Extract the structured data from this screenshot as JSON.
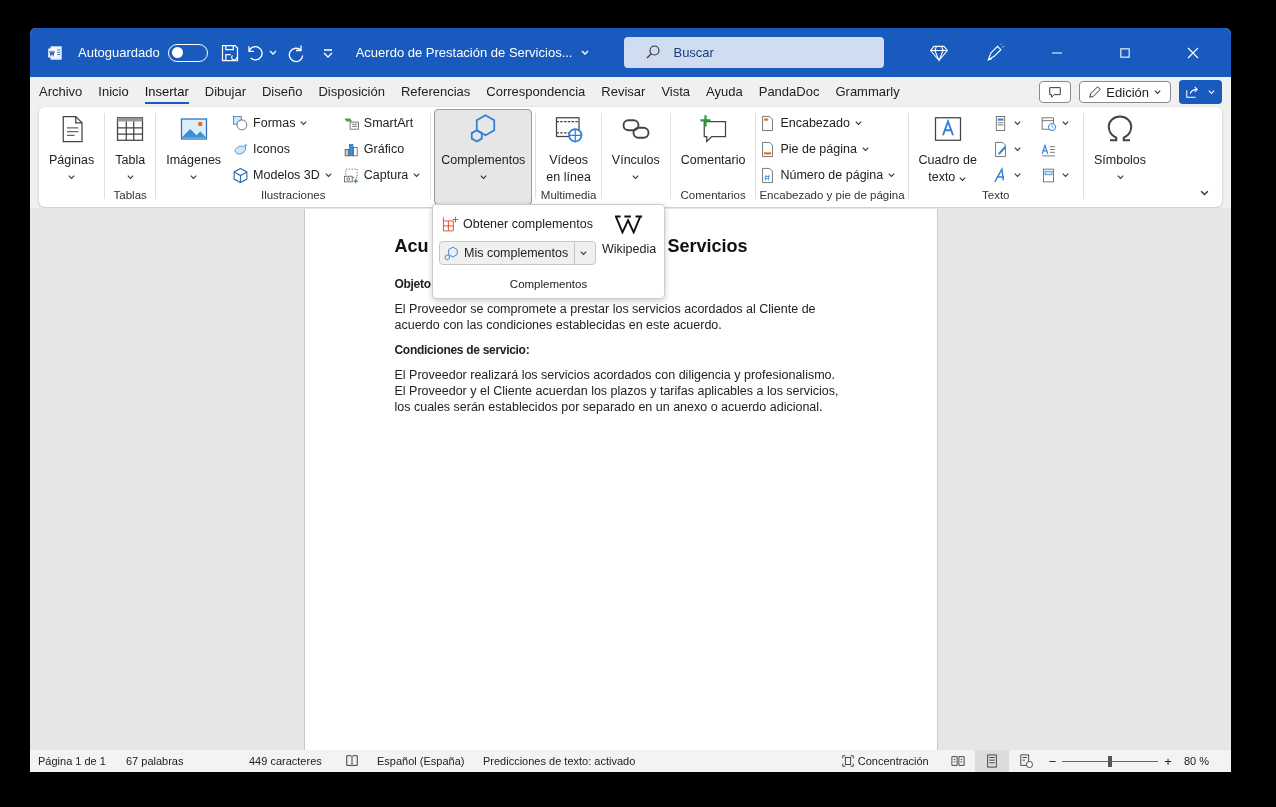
{
  "title_bar": {
    "autosave_label": "Autoguardado",
    "autosave_on": false,
    "doc_title": "Acuerdo de Prestación de Servicios...",
    "search_placeholder": "Buscar"
  },
  "tabs": [
    {
      "label": "Archivo",
      "selected": false
    },
    {
      "label": "Inicio",
      "selected": false
    },
    {
      "label": "Insertar",
      "selected": true
    },
    {
      "label": "Dibujar",
      "selected": false
    },
    {
      "label": "Diseño",
      "selected": false
    },
    {
      "label": "Disposición",
      "selected": false
    },
    {
      "label": "Referencias",
      "selected": false
    },
    {
      "label": "Correspondencia",
      "selected": false
    },
    {
      "label": "Revisar",
      "selected": false
    },
    {
      "label": "Vista",
      "selected": false
    },
    {
      "label": "Ayuda",
      "selected": false
    },
    {
      "label": "PandaDoc",
      "selected": false
    },
    {
      "label": "Grammarly",
      "selected": false
    }
  ],
  "edit_mode_label": "Edición",
  "ribbon_groups": [
    {
      "items": [
        {
          "kind": "large",
          "lines": [
            "Páginas"
          ],
          "dropdown": true,
          "open": false
        }
      ]
    },
    {
      "label": "Tablas",
      "items": [
        {
          "kind": "large",
          "lines": [
            "Tabla"
          ],
          "dropdown": true,
          "open": false
        }
      ]
    },
    {
      "label": "Ilustraciones",
      "items": [
        {
          "kind": "large",
          "lines": [
            "Imágenes"
          ],
          "dropdown": true,
          "open": false
        },
        {
          "kind": "small",
          "lines": [
            "Formas"
          ],
          "dropdown": true
        },
        {
          "kind": "small",
          "lines": [
            "Iconos"
          ],
          "dropdown": false
        },
        {
          "kind": "small",
          "lines": [
            "Modelos 3D"
          ],
          "dropdown": true
        },
        {
          "kind": "small",
          "lines": [
            "SmartArt"
          ],
          "dropdown": false
        },
        {
          "kind": "small",
          "lines": [
            "Gráfico"
          ],
          "dropdown": false
        },
        {
          "kind": "small",
          "lines": [
            "Captura"
          ],
          "dropdown": true
        }
      ]
    },
    {
      "items": [
        {
          "kind": "large",
          "lines": [
            "Complementos"
          ],
          "dropdown": true,
          "open": true
        }
      ]
    },
    {
      "label": "Multimedia",
      "items": [
        {
          "kind": "large",
          "lines": [
            "Vídeos",
            "en línea"
          ],
          "dropdown": false,
          "open": false
        }
      ]
    },
    {
      "items": [
        {
          "kind": "large",
          "lines": [
            "Vínculos"
          ],
          "dropdown": true,
          "open": false
        }
      ]
    },
    {
      "label": "Comentarios",
      "items": [
        {
          "kind": "large",
          "lines": [
            "Comentario"
          ],
          "dropdown": false,
          "open": false
        }
      ]
    },
    {
      "label": "Encabezado y pie de página",
      "items": [
        {
          "kind": "small",
          "lines": [
            "Encabezado"
          ],
          "dropdown": true
        },
        {
          "kind": "small",
          "lines": [
            "Pie de página"
          ],
          "dropdown": true
        },
        {
          "kind": "small",
          "lines": [
            "Número de página"
          ],
          "dropdown": true
        }
      ]
    },
    {
      "label": "Texto",
      "items": [
        {
          "kind": "large",
          "lines": [
            "Cuadro de",
            "texto"
          ],
          "dropdown": true,
          "open": false
        },
        {
          "kind": "icon",
          "dropdown": true
        },
        {
          "kind": "icon",
          "dropdown": true
        },
        {
          "kind": "icon",
          "dropdown": true
        },
        {
          "kind": "icon",
          "dropdown": true
        },
        {
          "kind": "icon",
          "dropdown": false
        },
        {
          "kind": "icon",
          "dropdown": true
        }
      ]
    },
    {
      "items": [
        {
          "kind": "large",
          "lines": [
            "Símbolos"
          ],
          "dropdown": true,
          "open": false
        }
      ]
    }
  ],
  "addins_menu": {
    "get_label": "Obtener complementos",
    "mine_label": "Mis complementos",
    "wiki_label": "Wikipedia",
    "group_label": "Complementos"
  },
  "document": {
    "heading_parts": [
      "Acu",
      "Servicios"
    ],
    "blocks": [
      {
        "kind": "label",
        "lines": [
          "Objeto"
        ]
      },
      {
        "kind": "para",
        "lines": [
          "El Proveedor se compromete a prestar los servicios acordados al Cliente de",
          "acuerdo con las condiciones establecidas en este acuerdo."
        ]
      },
      {
        "kind": "label",
        "lines": [
          "Condiciones de servicio:"
        ]
      },
      {
        "kind": "para",
        "lines": [
          "El Proveedor realizará los servicios acordados con diligencia y profesionalismo.",
          "El Proveedor y el Cliente acuerdan los plazos y tarifas aplicables a los servicios,",
          "los cuales serán establecidos por separado en un anexo o acuerdo adicional."
        ]
      }
    ]
  },
  "status_bar": {
    "page": "Página 1 de 1",
    "words": "67 palabras",
    "chars": "449 caracteres",
    "language": "Español (España)",
    "predictions": "Predicciones de texto: activado",
    "focus": "Concentración",
    "views": [
      {
        "selected": false
      },
      {
        "selected": true
      },
      {
        "selected": false
      }
    ],
    "zoom_out": "−",
    "zoom_in": "+",
    "zoom": {
      "level": 0.5
    },
    "zoom_label": "80 %"
  }
}
